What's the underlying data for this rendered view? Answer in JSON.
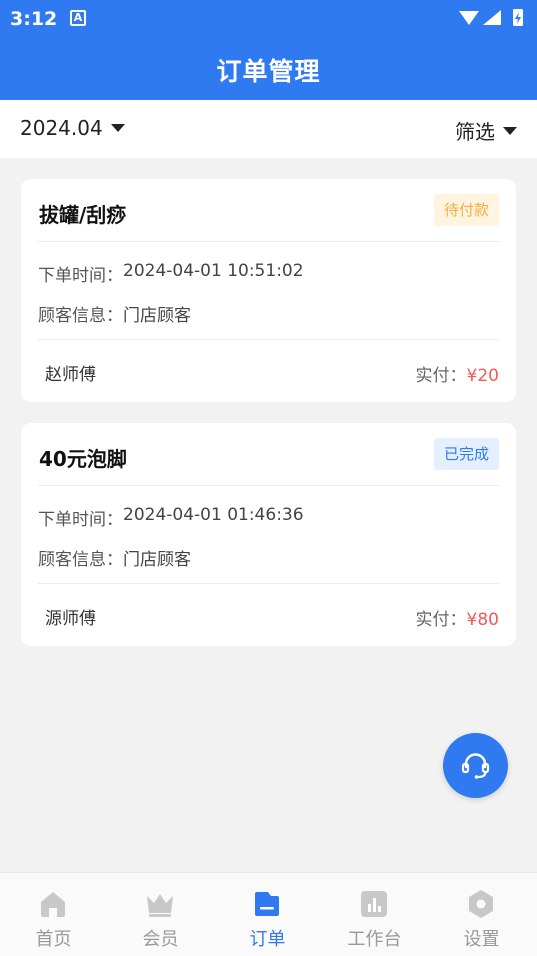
{
  "status_bar": {
    "time": "3:12",
    "notification_glyph": "A"
  },
  "header": {
    "title": "订单管理"
  },
  "filter": {
    "date": "2024.04",
    "filter_label": "筛选"
  },
  "orders": [
    {
      "title": "拔罐/刮痧",
      "status": "待付款",
      "order_time_label": "下单时间：",
      "order_time": "2024-04-01 10:51:02",
      "customer_label": "顾客信息：",
      "customer": "门店顾客",
      "worker": "赵师傅",
      "paid_label": "实付：",
      "paid_amount": "¥20"
    },
    {
      "title": "40元泡脚",
      "status": "已完成",
      "order_time_label": "下单时间：",
      "order_time": "2024-04-01 01:46:36",
      "customer_label": "顾客信息：",
      "customer": "门店顾客",
      "worker": "源师傅",
      "paid_label": "实付：",
      "paid_amount": "¥80"
    }
  ],
  "tabs": [
    {
      "label": "首页",
      "icon": "home-icon",
      "active": false
    },
    {
      "label": "会员",
      "icon": "crown-icon",
      "active": false
    },
    {
      "label": "订单",
      "icon": "order-icon",
      "active": true
    },
    {
      "label": "工作台",
      "icon": "chart-icon",
      "active": false
    },
    {
      "label": "设置",
      "icon": "gear-icon",
      "active": false
    }
  ],
  "colors": {
    "primary": "#2f7af0",
    "pending_text": "#f4b040",
    "pending_bg": "#fff4e0",
    "done_bg": "#e4f0ff",
    "amount": "#f25a5a",
    "inactive_tab": "#999999"
  }
}
